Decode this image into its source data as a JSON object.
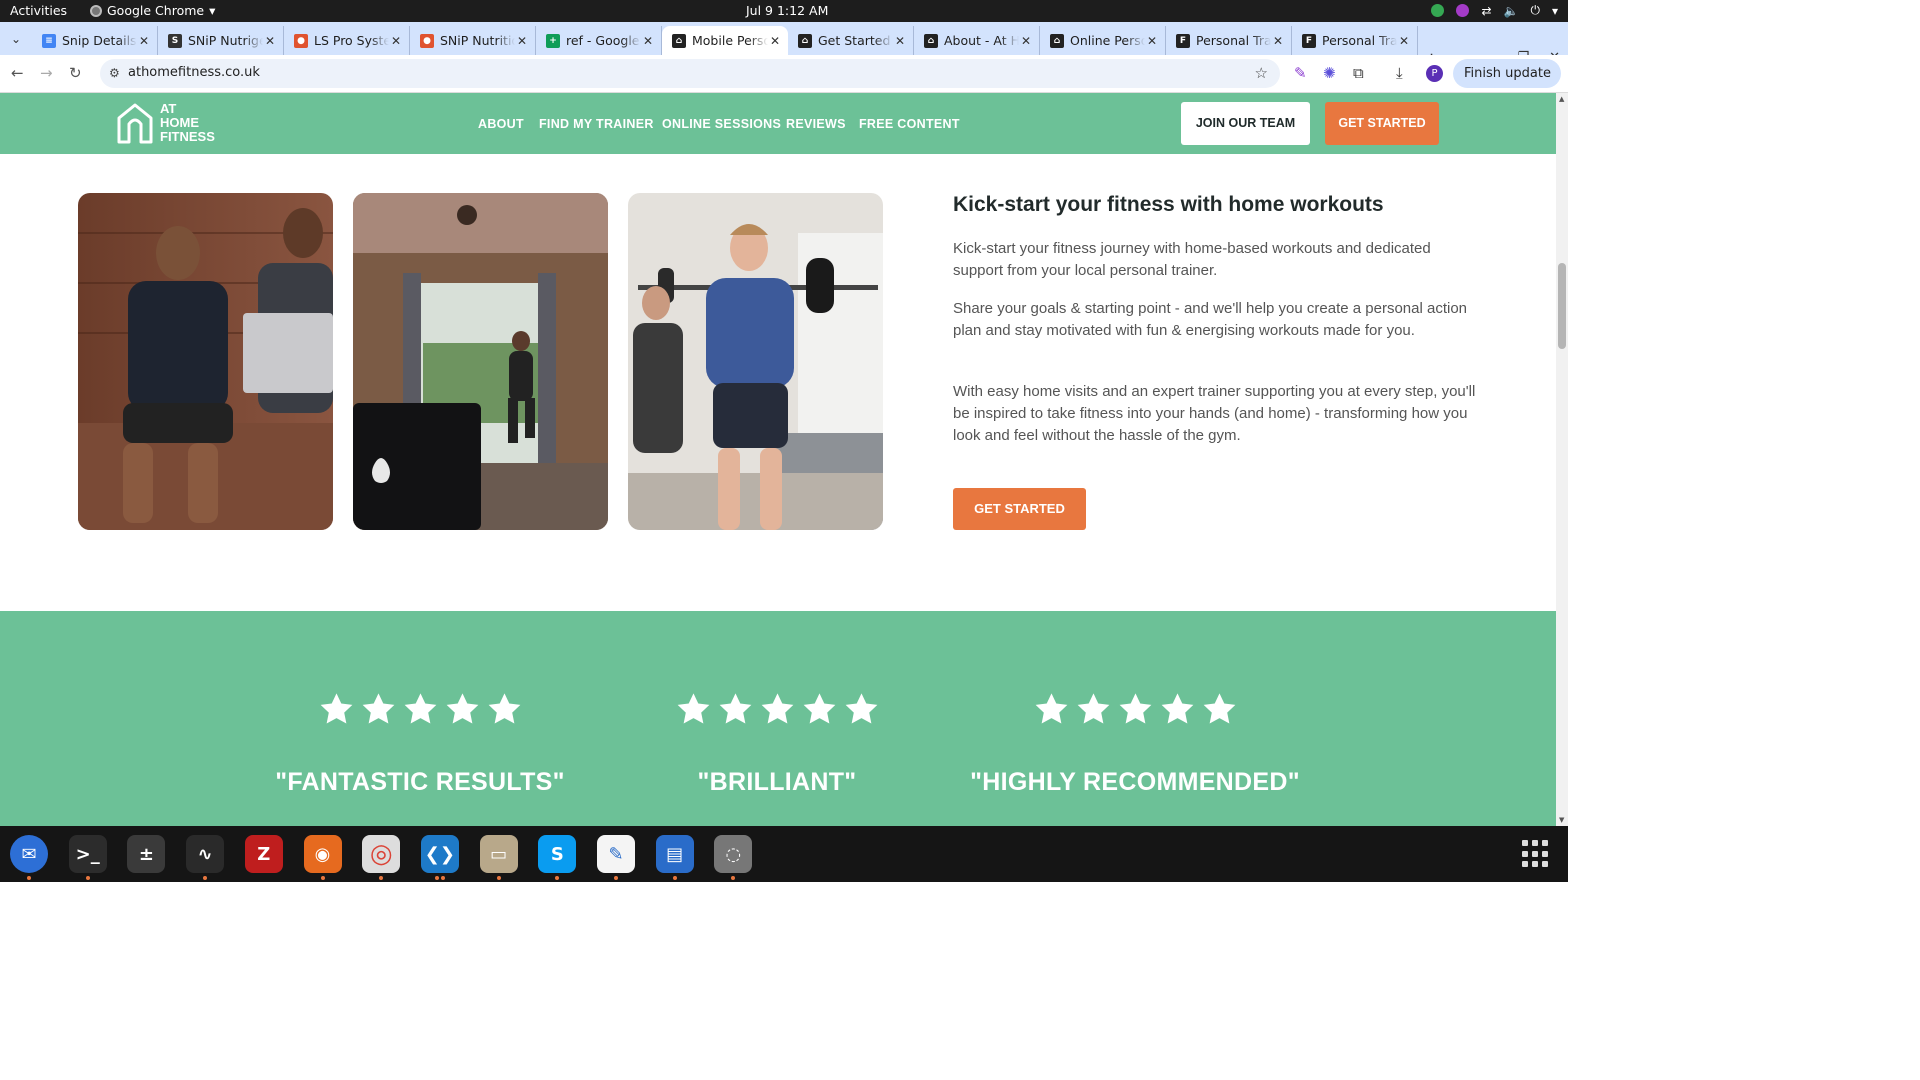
{
  "system": {
    "activities": "Activities",
    "app_name": "Google Chrome",
    "clock": "Jul 9  1:12 AM"
  },
  "browser": {
    "tabs": [
      {
        "title": "Snip Details",
        "icon": "docs-icon",
        "color": "#4285f4"
      },
      {
        "title": "SNiP Nutrigenomics",
        "icon": "snip-icon",
        "color": "#333333"
      },
      {
        "title": "LS Pro Systems",
        "icon": "ls-icon",
        "color": "#e0532f"
      },
      {
        "title": "SNiP Nutrition",
        "icon": "snip-red-icon",
        "color": "#e0532f"
      },
      {
        "title": "ref - Google Sheets",
        "icon": "sheets-icon",
        "color": "#0f9d58"
      },
      {
        "title": "Mobile Personal Trainer",
        "icon": "athome-icon",
        "color": "#222222",
        "active": true
      },
      {
        "title": "Get Started",
        "icon": "athome-icon",
        "color": "#222222"
      },
      {
        "title": "About - At Home Fitness",
        "icon": "athome-icon",
        "color": "#222222"
      },
      {
        "title": "Online Personal Training",
        "icon": "athome-icon",
        "color": "#222222"
      },
      {
        "title": "Personal Trainer",
        "icon": "fs-icon",
        "color": "#222222"
      },
      {
        "title": "Personal Trainer",
        "icon": "fs-icon",
        "color": "#222222"
      }
    ],
    "url": "athomefitness.co.uk",
    "finish_update": "Finish update",
    "profile_initial": "P"
  },
  "site": {
    "logo": [
      "AT",
      "HOME",
      "FITNESS"
    ],
    "nav": [
      "ABOUT",
      "FIND MY TRAINER",
      "ONLINE SESSIONS",
      "REVIEWS",
      "FREE CONTENT"
    ],
    "join_label": "JOIN OUR TEAM",
    "get_started_label": "GET STARTED",
    "accent_green": "#6cc197",
    "accent_orange": "#e8773f"
  },
  "main": {
    "heading": "Kick-start your fitness with home workouts",
    "paragraphs": [
      "Kick-start your fitness journey with home-based workouts and dedicated support from your local personal trainer.",
      "Share your goals & starting point - and we'll help you create a personal action plan and stay motivated with fun & energising workouts made for you.",
      "With easy home visits and an expert trainer supporting you at every step, you'll be inspired to take fitness into your hands (and home) - transforming how you look and feel without the hassle of the gym."
    ],
    "cta": "GET STARTED"
  },
  "reviews": [
    {
      "stars": 5,
      "quote": "\"FANTASTIC RESULTS\""
    },
    {
      "stars": 5,
      "quote": "\"BRILLIANT\""
    },
    {
      "stars": 5,
      "quote": "\"HIGHLY RECOMMENDED\""
    }
  ],
  "dock": [
    "thunderbird-icon",
    "terminal-icon",
    "calculator-icon",
    "system-monitor-icon",
    "filezilla-icon",
    "firefox-icon",
    "chrome-icon",
    "vscode-icon",
    "files-icon",
    "skype-icon",
    "text-editor-icon",
    "libreoffice-writer-icon",
    "disks-icon"
  ]
}
